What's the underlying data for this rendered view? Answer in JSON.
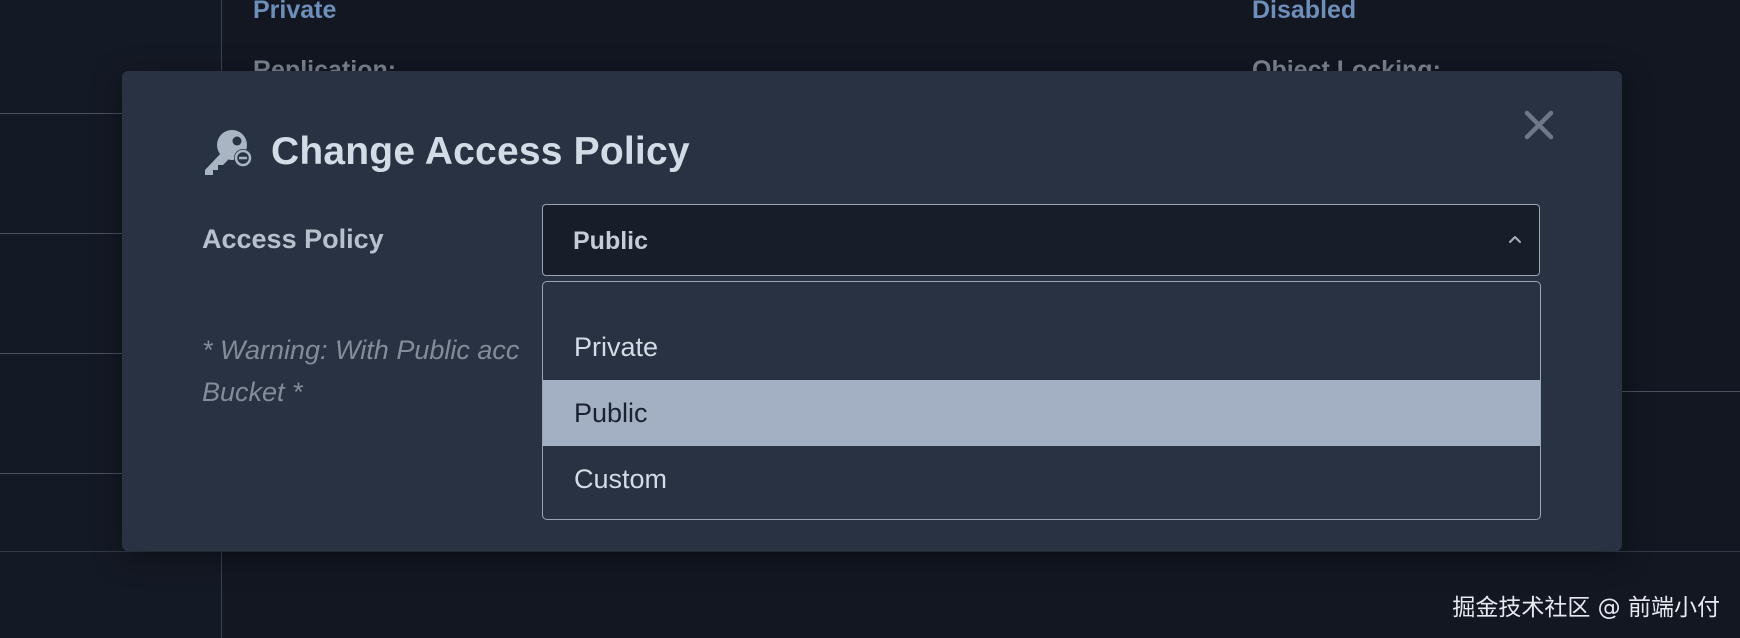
{
  "background": {
    "bucket_access_value": "Private",
    "replication_label": "Replication:",
    "versioning_value": "Disabled",
    "object_locking_label": "Object Locking:"
  },
  "modal": {
    "title": "Change Access Policy",
    "title_icon": "key-icon",
    "close_icon": "close-icon",
    "field_label": "Access Policy",
    "select": {
      "value": "Public",
      "chevron_icon": "chevron-up-icon"
    },
    "warning_text": "* Warning: With Public acc",
    "warning_text_line2": "Bucket *",
    "options": [
      {
        "label": "Private",
        "selected": false
      },
      {
        "label": "Public",
        "selected": true
      },
      {
        "label": "Custom",
        "selected": false
      }
    ]
  },
  "watermark": "掘金技术社区 @ 前端小付",
  "colors": {
    "page_background": "#121722",
    "modal_background": "#283242",
    "select_background": "#171d29",
    "selected_option": "#a3afc3",
    "link_color": "#6e8fba"
  }
}
